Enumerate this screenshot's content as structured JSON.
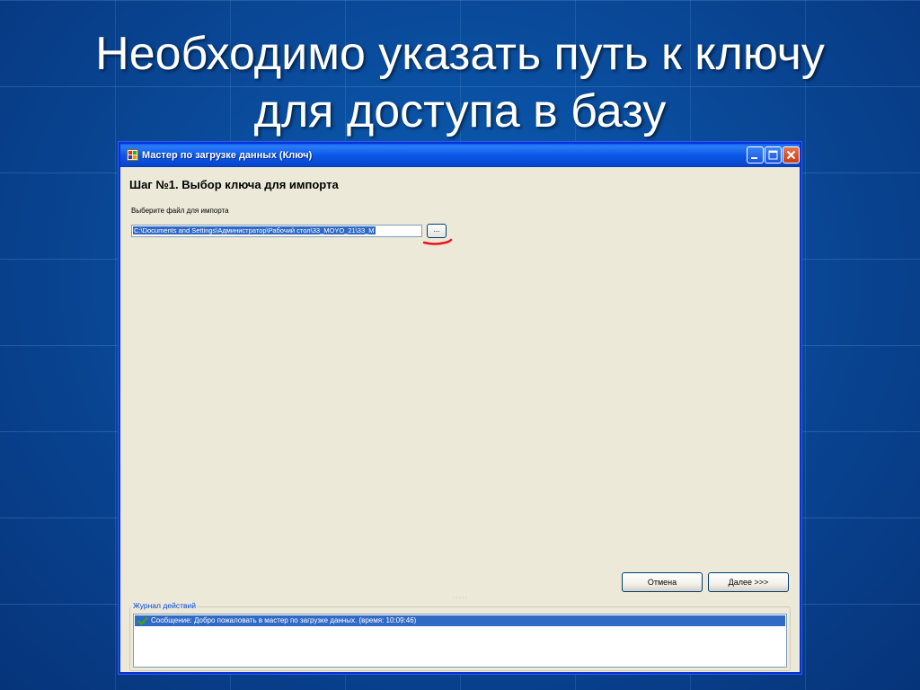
{
  "slide": {
    "title_line1": "Необходимо указать путь к ключу",
    "title_line2": "для доступа в базу"
  },
  "window": {
    "title": "Мастер по загрузке данных (Ключ)",
    "controls": {
      "minimize": "",
      "maximize": "",
      "close": ""
    }
  },
  "step": {
    "heading": "Шаг №1.  Выбор ключа для импорта",
    "file_label": "Выберите файл для импорта",
    "file_path": "C:\\Documents and Settings\\Администратор\\Рабочий стол\\33_MOYO_21\\33_M",
    "browse_label": "..."
  },
  "buttons": {
    "cancel": "Отмена",
    "next": "Далее >>>"
  },
  "log": {
    "legend": "Журнал действий",
    "entries": [
      {
        "text": "Сообщение: Добро пожаловать в мастер по загрузке данных. (время: 10:09:46)"
      }
    ]
  },
  "colors": {
    "slide_bg": "#0a4a9a",
    "titlebar": "#0a58e8",
    "selection": "#316ac5",
    "red_underline": "#e8141b",
    "check_green": "#3fa21c"
  },
  "icons": {
    "app": "app-window-icon",
    "log_entry": "check-icon"
  }
}
